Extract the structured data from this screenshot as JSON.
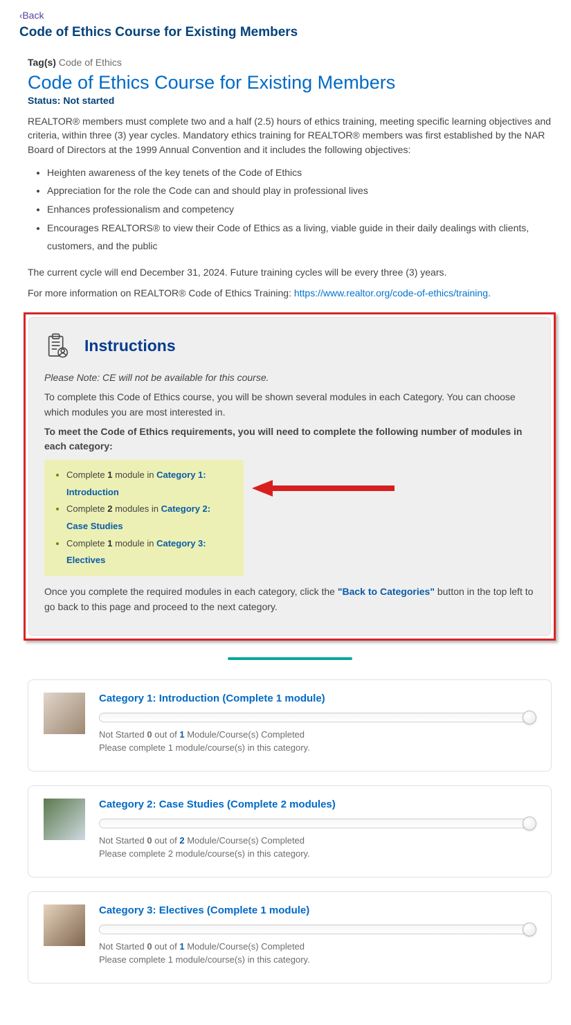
{
  "nav": {
    "back_chev": "‹",
    "back_label": "Back"
  },
  "page_title": "Code of Ethics Course for Existing Members",
  "tags": {
    "label": "Tag(s)",
    "value": "Code of Ethics"
  },
  "course": {
    "heading": "Code of Ethics Course for Existing Members",
    "status_label": "Status:",
    "status_value": "Not started",
    "intro": "REALTOR® members must complete two and a half (2.5) hours of ethics training, meeting specific learning objectives and criteria, within three (3) year cycles. Mandatory ethics training for REALTOR® members was first established by the NAR Board of Directors at the 1999 Annual Convention and it includes the following objectives:",
    "objectives": [
      "Heighten awareness of the key tenets of the Code of Ethics",
      "Appreciation for the role the Code can and should play in professional lives",
      "Enhances professionalism and competency",
      "Encourages REALTORS® to view their Code of Ethics as a living, viable guide in their daily dealings with clients, customers, and the public"
    ],
    "cycle_note": "The current cycle will end December 31, 2024. Future training cycles will be every three (3) years.",
    "more_info_pre": "For more information on REALTOR® Code of Ethics Training: ",
    "more_info_link": "https://www.realtor.org/code-of-ethics/training",
    "more_info_post": "."
  },
  "instructions": {
    "title": "Instructions",
    "note_italic": "Please Note: CE will not be available for this course.",
    "p1": "To complete this Code of Ethics course, you will be shown several modules in each Category. You can choose which modules you are most interested in.",
    "p2_strong": "To meet the Code of Ethics requirements, you will need to complete the following number of modules in each category:",
    "reqs": [
      {
        "pre": "Complete ",
        "n": "1",
        "mid": " module in ",
        "cat": "Category 1: Introduction"
      },
      {
        "pre": "Complete ",
        "n": "2",
        "mid": " modules in ",
        "cat": "Category 2: Case Studies"
      },
      {
        "pre": "Complete ",
        "n": "1",
        "mid": " module in ",
        "cat": "Category 3: Electives"
      }
    ],
    "p3_a": "Once you complete the required modules in each category, click the ",
    "p3_btn": "\"Back to Categories\"",
    "p3_b": " button in the top left to go back to this page and proceed to the next category."
  },
  "categories": [
    {
      "title": "Category 1: Introduction (Complete 1 module)",
      "status": "Not Started",
      "done": "0",
      "sep": " out of ",
      "total": "1",
      "tail": " Module/Course(s) Completed",
      "note": "Please complete 1 module/course(s) in this category."
    },
    {
      "title": "Category 2: Case Studies (Complete 2 modules)",
      "status": "Not Started",
      "done": "0",
      "sep": " out of ",
      "total": "2",
      "tail": " Module/Course(s) Completed",
      "note": "Please complete 2 module/course(s) in this category."
    },
    {
      "title": "Category 3: Electives (Complete 1 module)",
      "status": "Not Started",
      "done": "0",
      "sep": " out of ",
      "total": "1",
      "tail": " Module/Course(s) Completed",
      "note": "Please complete 1 module/course(s) in this category."
    }
  ]
}
